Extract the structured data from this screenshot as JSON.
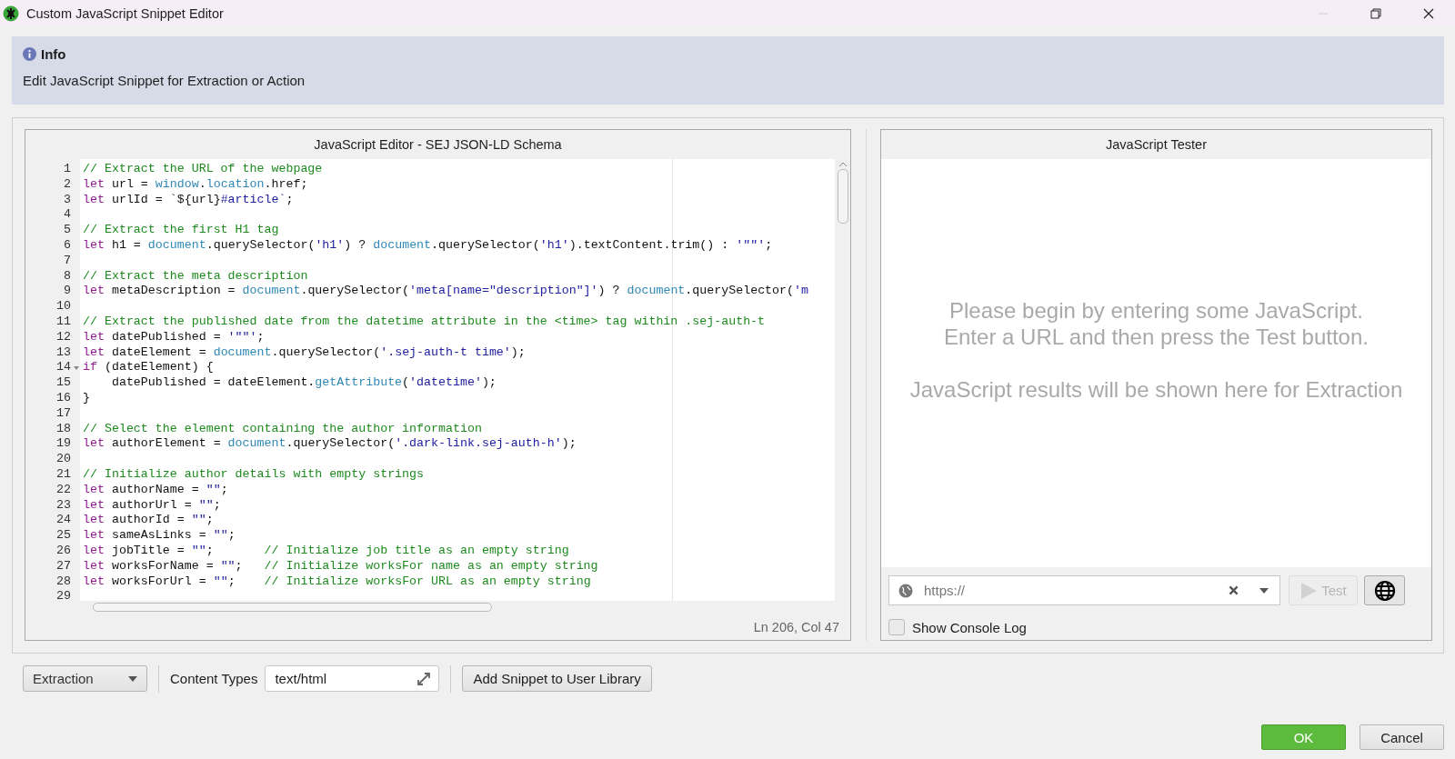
{
  "window": {
    "title": "Custom JavaScript Snippet Editor"
  },
  "info": {
    "heading": "Info",
    "text": "Edit JavaScript Snippet for Extraction or Action"
  },
  "editor": {
    "title": "JavaScript Editor - SEJ JSON-LD Schema",
    "status": "Ln 206, Col 47",
    "lines": [
      {
        "number": "1",
        "tokens": [
          {
            "kind": "comment",
            "text": "// Extract the URL of the webpage"
          }
        ]
      },
      {
        "number": "2",
        "tokens": [
          {
            "kind": "keyword",
            "text": "let"
          },
          {
            "kind": "plain",
            "text": " url = "
          },
          {
            "kind": "builtin",
            "text": "window"
          },
          {
            "kind": "plain",
            "text": "."
          },
          {
            "kind": "builtin",
            "text": "location"
          },
          {
            "kind": "plain",
            "text": ".href;"
          }
        ]
      },
      {
        "number": "3",
        "tokens": [
          {
            "kind": "keyword",
            "text": "let"
          },
          {
            "kind": "plain",
            "text": " urlId = `${url}"
          },
          {
            "kind": "string",
            "text": "#article`"
          },
          {
            "kind": "plain",
            "text": ";"
          }
        ]
      },
      {
        "number": "4"
      },
      {
        "number": "5",
        "tokens": [
          {
            "kind": "comment",
            "text": "// Extract the first H1 tag"
          }
        ]
      },
      {
        "number": "6",
        "tokens": [
          {
            "kind": "keyword",
            "text": "let"
          },
          {
            "kind": "plain",
            "text": " h1 = "
          },
          {
            "kind": "builtin",
            "text": "document"
          },
          {
            "kind": "plain",
            "text": ".querySelector("
          },
          {
            "kind": "string",
            "text": "'h1'"
          },
          {
            "kind": "plain",
            "text": ") ? "
          },
          {
            "kind": "builtin",
            "text": "document"
          },
          {
            "kind": "plain",
            "text": ".querySelector("
          },
          {
            "kind": "string",
            "text": "'h1'"
          },
          {
            "kind": "plain",
            "text": ").textContent.trim() : "
          },
          {
            "kind": "string",
            "text": "'\"\"'"
          },
          {
            "kind": "plain",
            "text": ";"
          }
        ]
      },
      {
        "number": "7"
      },
      {
        "number": "8",
        "tokens": [
          {
            "kind": "comment",
            "text": "// Extract the meta description"
          }
        ]
      },
      {
        "number": "9",
        "tokens": [
          {
            "kind": "keyword",
            "text": "let"
          },
          {
            "kind": "plain",
            "text": " metaDescription = "
          },
          {
            "kind": "builtin",
            "text": "document"
          },
          {
            "kind": "plain",
            "text": ".querySelector("
          },
          {
            "kind": "string",
            "text": "'meta[name=\"description\"]'"
          },
          {
            "kind": "plain",
            "text": ") ? "
          },
          {
            "kind": "builtin",
            "text": "document"
          },
          {
            "kind": "plain",
            "text": ".querySelector("
          },
          {
            "kind": "string",
            "text": "'m"
          }
        ]
      },
      {
        "number": "10"
      },
      {
        "number": "11",
        "tokens": [
          {
            "kind": "comment",
            "text": "// Extract the published date from the datetime attribute in the <time> tag within .sej-auth-t"
          }
        ]
      },
      {
        "number": "12",
        "tokens": [
          {
            "kind": "keyword",
            "text": "let"
          },
          {
            "kind": "plain",
            "text": " datePublished = "
          },
          {
            "kind": "string",
            "text": "'\"\"'"
          },
          {
            "kind": "plain",
            "text": ";"
          }
        ]
      },
      {
        "number": "13",
        "tokens": [
          {
            "kind": "keyword",
            "text": "let"
          },
          {
            "kind": "plain",
            "text": " dateElement = "
          },
          {
            "kind": "builtin",
            "text": "document"
          },
          {
            "kind": "plain",
            "text": ".querySelector("
          },
          {
            "kind": "string",
            "text": "'.sej-auth-t time'"
          },
          {
            "kind": "plain",
            "text": ");"
          }
        ]
      },
      {
        "number": "14",
        "expanded": true,
        "tokens": [
          {
            "kind": "keyword",
            "text": "if"
          },
          {
            "kind": "plain",
            "text": " (dateElement) {"
          }
        ]
      },
      {
        "number": "15",
        "tokens": [
          {
            "kind": "plain",
            "text": "    datePublished = dateElement."
          },
          {
            "kind": "builtin",
            "text": "getAttribute"
          },
          {
            "kind": "plain",
            "text": "("
          },
          {
            "kind": "string",
            "text": "'datetime'"
          },
          {
            "kind": "plain",
            "text": ");"
          }
        ]
      },
      {
        "number": "16",
        "tokens": [
          {
            "kind": "plain",
            "text": "}"
          }
        ]
      },
      {
        "number": "17"
      },
      {
        "number": "18",
        "tokens": [
          {
            "kind": "comment",
            "text": "// Select the element containing the author information"
          }
        ]
      },
      {
        "number": "19",
        "tokens": [
          {
            "kind": "keyword",
            "text": "let"
          },
          {
            "kind": "plain",
            "text": " authorElement = "
          },
          {
            "kind": "builtin",
            "text": "document"
          },
          {
            "kind": "plain",
            "text": ".querySelector("
          },
          {
            "kind": "string",
            "text": "'.dark-link.sej-auth-h'"
          },
          {
            "kind": "plain",
            "text": ");"
          }
        ]
      },
      {
        "number": "20"
      },
      {
        "number": "21",
        "tokens": [
          {
            "kind": "comment",
            "text": "// Initialize author details with empty strings"
          }
        ]
      },
      {
        "number": "22",
        "tokens": [
          {
            "kind": "keyword",
            "text": "let"
          },
          {
            "kind": "plain",
            "text": " authorName = "
          },
          {
            "kind": "string",
            "text": "\"\""
          },
          {
            "kind": "plain",
            "text": ";"
          }
        ]
      },
      {
        "number": "23",
        "tokens": [
          {
            "kind": "keyword",
            "text": "let"
          },
          {
            "kind": "plain",
            "text": " authorUrl = "
          },
          {
            "kind": "string",
            "text": "\"\""
          },
          {
            "kind": "plain",
            "text": ";"
          }
        ]
      },
      {
        "number": "24",
        "tokens": [
          {
            "kind": "keyword",
            "text": "let"
          },
          {
            "kind": "plain",
            "text": " authorId = "
          },
          {
            "kind": "string",
            "text": "\"\""
          },
          {
            "kind": "plain",
            "text": ";"
          }
        ]
      },
      {
        "number": "25",
        "tokens": [
          {
            "kind": "keyword",
            "text": "let"
          },
          {
            "kind": "plain",
            "text": " sameAsLinks = "
          },
          {
            "kind": "string",
            "text": "\"\""
          },
          {
            "kind": "plain",
            "text": ";"
          }
        ]
      },
      {
        "number": "26",
        "tokens": [
          {
            "kind": "keyword",
            "text": "let"
          },
          {
            "kind": "plain",
            "text": " jobTitle = "
          },
          {
            "kind": "string",
            "text": "\"\""
          },
          {
            "kind": "plain",
            "text": ";       "
          },
          {
            "kind": "comment",
            "text": "// Initialize job title as an empty string"
          }
        ]
      },
      {
        "number": "27",
        "tokens": [
          {
            "kind": "keyword",
            "text": "let"
          },
          {
            "kind": "plain",
            "text": " worksForName = "
          },
          {
            "kind": "string",
            "text": "\"\""
          },
          {
            "kind": "plain",
            "text": ";   "
          },
          {
            "kind": "comment",
            "text": "// Initialize worksFor name as an empty string"
          }
        ]
      },
      {
        "number": "28",
        "tokens": [
          {
            "kind": "keyword",
            "text": "let"
          },
          {
            "kind": "plain",
            "text": " worksForUrl = "
          },
          {
            "kind": "string",
            "text": "\"\""
          },
          {
            "kind": "plain",
            "text": ";    "
          },
          {
            "kind": "comment",
            "text": "// Initialize worksFor URL as an empty string"
          }
        ]
      },
      {
        "number": "29"
      }
    ]
  },
  "tester": {
    "title": "JavaScript Tester",
    "messages": [
      "Please begin by entering some JavaScript.",
      "Enter a URL and then press the Test button.",
      "JavaScript results will be shown here for Extraction"
    ],
    "url_field": {
      "placeholder": "https://"
    },
    "test_button": {
      "label": "Test",
      "disabled": true
    },
    "console_log": {
      "label": "Show Console Log",
      "checked": false
    }
  },
  "toolbar": {
    "mode": "Extraction",
    "content_types_label": "Content Types",
    "content_types": "text/html",
    "library_button": "Add Snippet to User Library"
  },
  "buttons": [
    {
      "label": "OK",
      "kind": "primary"
    },
    {
      "label": "Cancel",
      "kind": "secondary"
    }
  ]
}
